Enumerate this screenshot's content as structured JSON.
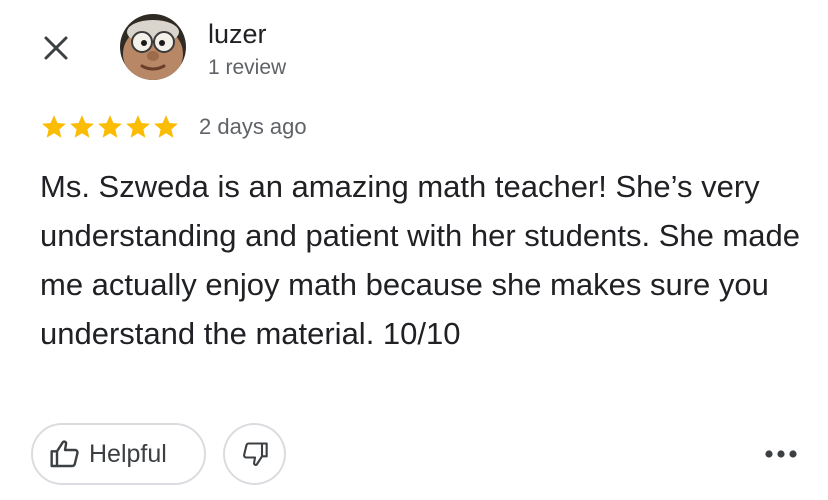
{
  "header": {
    "close_icon": "close-icon",
    "reviewer_name": "luzer",
    "reviewer_count": "1 review"
  },
  "review": {
    "rating": 5,
    "rating_max": 5,
    "star_color": "#fbbc04",
    "date": "2 days ago",
    "text": "Ms. Szweda is an amazing math teacher! She’s very understanding and patient with her students. She made me actually enjoy math because she makes sure you understand the material. 10/10"
  },
  "actions": {
    "helpful_label": "Helpful",
    "helpful_icon": "thumbs-up-icon",
    "unhelpful_icon": "thumbs-down-icon",
    "more_icon": "more-horizontal-icon"
  }
}
